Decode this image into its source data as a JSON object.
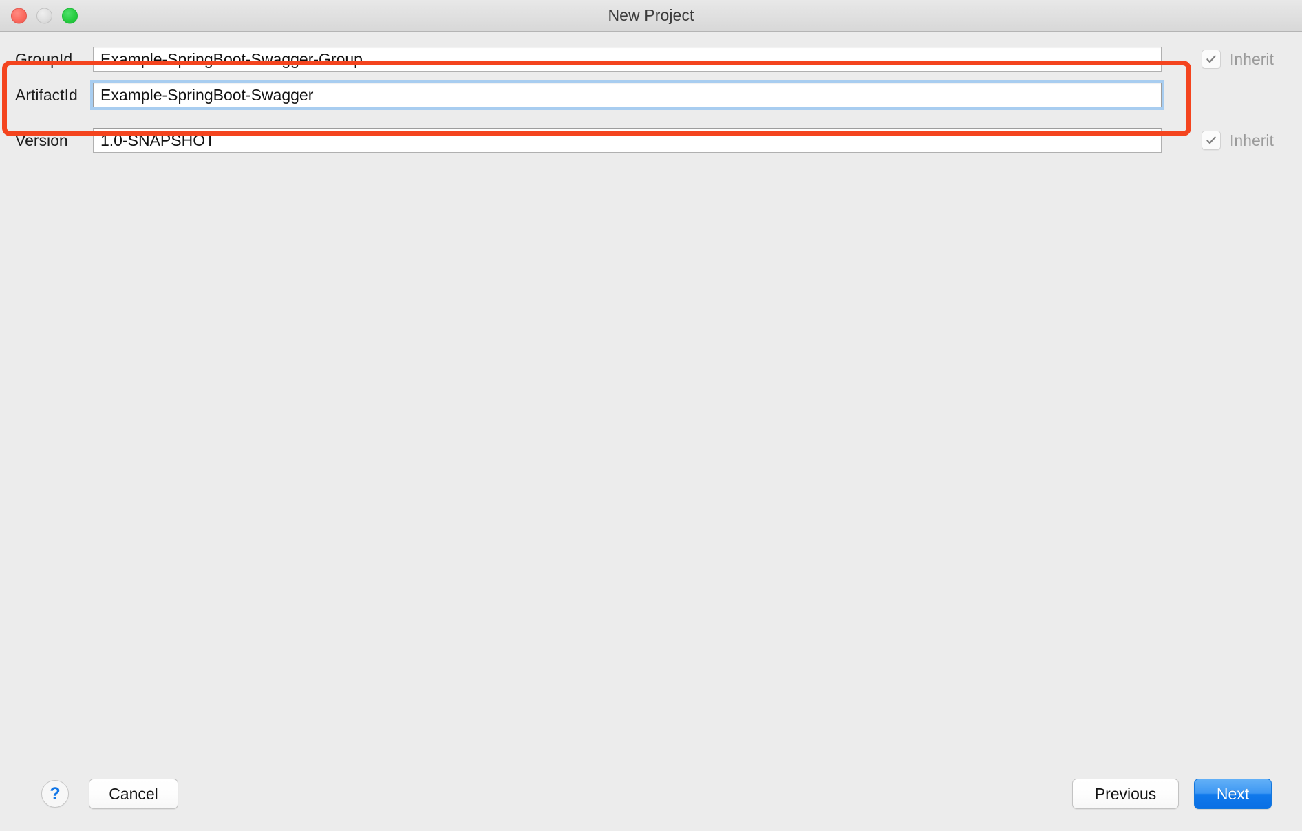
{
  "window": {
    "title": "New Project",
    "traffic_lights": [
      {
        "name": "close",
        "color": "#fb6a5f"
      },
      {
        "name": "minimize",
        "color": "#dedede"
      },
      {
        "name": "maximize",
        "color": "#28cd41"
      }
    ]
  },
  "form": {
    "fields": [
      {
        "label": "GroupId",
        "value": "Example-SpringBoot-Swagger-Group",
        "focused": false,
        "inherit": {
          "label": "Inherit",
          "checked": true,
          "enabled": false
        }
      },
      {
        "label": "ArtifactId",
        "value": "Example-SpringBoot-Swagger",
        "focused": true,
        "inherit": null
      },
      {
        "label": "Version",
        "value": "1.0-SNAPSHOT",
        "focused": false,
        "inherit": {
          "label": "Inherit",
          "checked": true,
          "enabled": false
        }
      }
    ]
  },
  "annotation": {
    "color": "#f4441e",
    "describes": "highlight-around-groupid-and-artifactid-rows"
  },
  "footer": {
    "help_label": "?",
    "cancel_label": "Cancel",
    "previous_label": "Previous",
    "next_label": "Next",
    "next_accent_color": "#1079ec"
  }
}
